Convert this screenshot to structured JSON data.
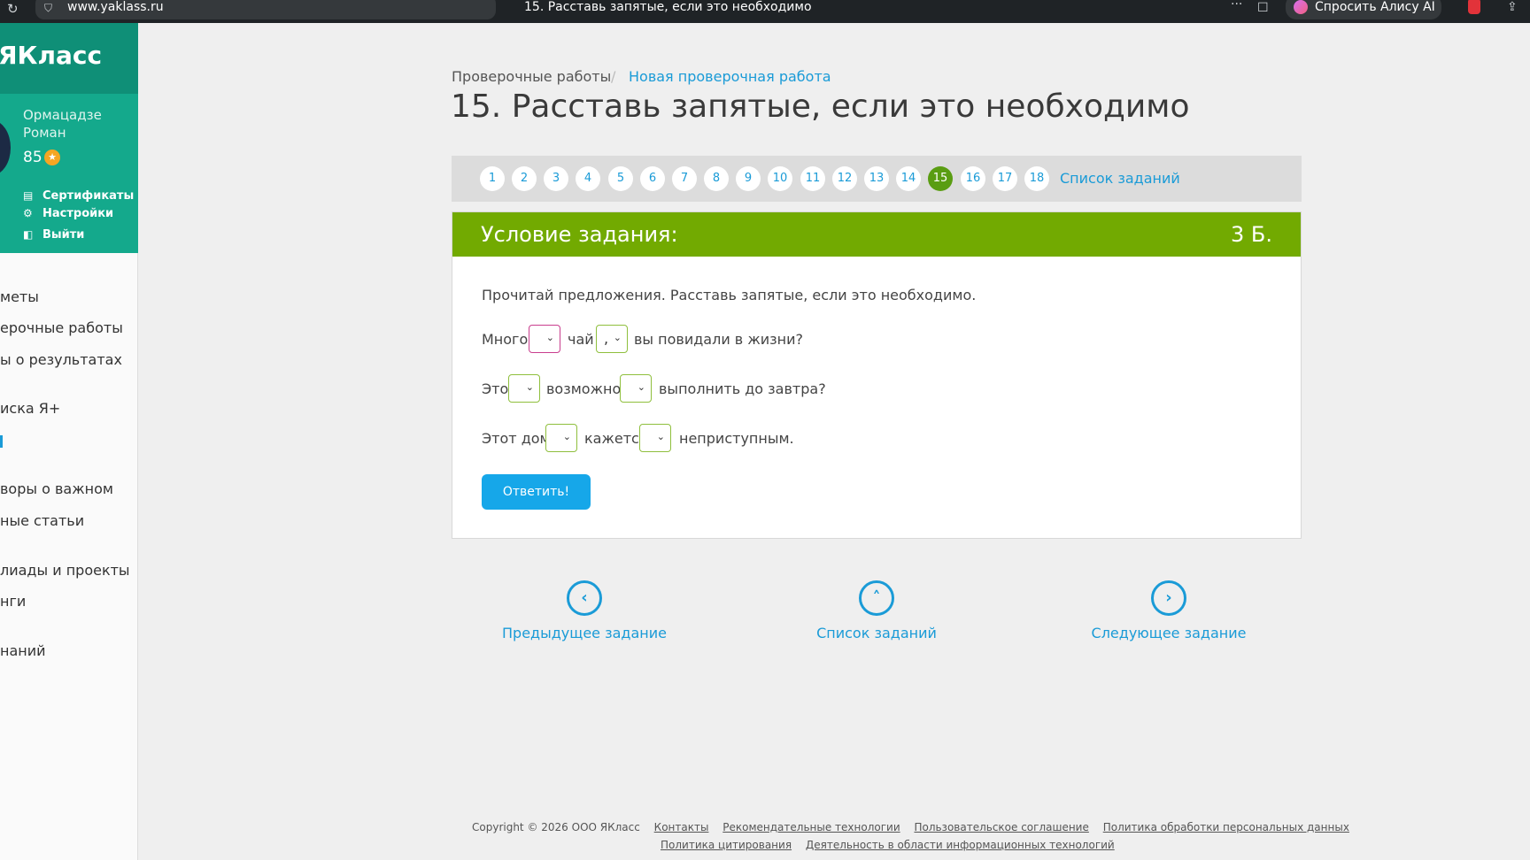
{
  "browser": {
    "url": "www.yaklass.ru",
    "tab_title": "15. Расставь запятые, если это необходимо",
    "alisa": "Спросить Алису AI"
  },
  "sidebar": {
    "logo": "ЯКласс",
    "user_name": "Ормацадзе Роман",
    "points": "85",
    "profile_menu": [
      "Сертификаты",
      "Настройки",
      "Выйти"
    ],
    "nav": [
      "меты",
      "ерочные работы",
      "ы о результатах",
      "иска Я+",
      "воры о важном",
      "ные статьи",
      "лиады и проекты",
      "нги",
      "наний"
    ]
  },
  "breadcrumb": {
    "root": "Проверочные работы",
    "separator": "/",
    "current": "Новая проверочная работа"
  },
  "title": "15. Расставь запятые, если это необходимо",
  "task_nav": {
    "numbers": [
      "1",
      "2",
      "3",
      "4",
      "5",
      "6",
      "7",
      "8",
      "9",
      "10",
      "11",
      "12",
      "13",
      "14",
      "15",
      "16",
      "17",
      "18"
    ],
    "active": "15",
    "list_label": "Список заданий"
  },
  "task": {
    "header": "Условие задания:",
    "score": "3 Б.",
    "instruction": "Прочитай предложения. Расставь запятые, если это необходимо.",
    "rows": [
      {
        "parts": [
          "Много",
          "чай",
          "вы повидали в жизни?"
        ],
        "values": [
          "",
          ","
        ]
      },
      {
        "parts": [
          "Это",
          "возможно",
          "выполнить до завтра?"
        ],
        "values": [
          "",
          ""
        ]
      },
      {
        "parts": [
          "Этот дом",
          "кажется",
          "неприступным."
        ],
        "values": [
          "",
          ""
        ]
      }
    ],
    "submit": "Ответить!"
  },
  "bottom_nav": {
    "prev": "Предыдущее задание",
    "list": "Список заданий",
    "next": "Следующее задание"
  },
  "footer": {
    "copyright": "Copyright © 2026 ООО ЯКласс",
    "links_row1": [
      "Контакты",
      "Рекомендательные технологии",
      "Пользовательское соглашение",
      "Политика обработки персональных данных"
    ],
    "links_row2": [
      "Политика цитирования",
      "Деятельность в области информационных технологий"
    ]
  },
  "colors": {
    "accent": "#1a9bd7",
    "header_green": "#72aa01",
    "sidebar_teal": "#14a98c",
    "active_number": "#5a9d12"
  }
}
